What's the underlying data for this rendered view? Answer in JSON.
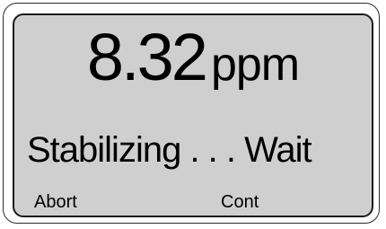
{
  "display": {
    "reading_value": "8.32",
    "reading_unit": "ppm",
    "status_text": "Stabilizing . . . Wait"
  },
  "softkeys": {
    "left_label": "Abort",
    "right_label": "Cont"
  },
  "colors": {
    "screen_background": "#cfcfcf",
    "text": "#000000",
    "frame": "#1a1a1a"
  }
}
